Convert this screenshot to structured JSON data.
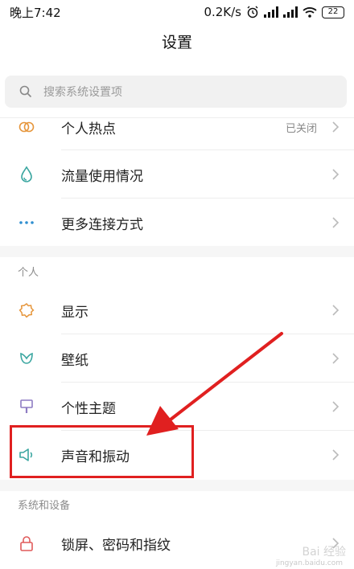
{
  "status": {
    "time": "晚上7:42",
    "speed": "0.2K/s",
    "battery": "22"
  },
  "header": {
    "title": "设置"
  },
  "search": {
    "placeholder": "搜索系统设置项"
  },
  "connection": [
    {
      "label": "个人热点",
      "value": "已关闭",
      "icon": "hotspot-icon"
    },
    {
      "label": "流量使用情况",
      "icon": "data-drop-icon"
    },
    {
      "label": "更多连接方式",
      "icon": "more-dots-icon"
    }
  ],
  "personal": {
    "title": "个人",
    "items": [
      {
        "label": "显示",
        "icon": "display-sun-icon"
      },
      {
        "label": "壁纸",
        "icon": "wallpaper-flower-icon"
      },
      {
        "label": "个性主题",
        "icon": "theme-brush-icon"
      },
      {
        "label": "声音和振动",
        "icon": "speaker-icon"
      }
    ]
  },
  "system": {
    "title": "系统和设备",
    "items": [
      {
        "label": "锁屏、密码和指纹",
        "icon": "lock-icon"
      }
    ]
  },
  "watermark": {
    "text": "Bai 经验",
    "sub": "jingyan.baidu.com"
  },
  "colors": {
    "highlight": "#e02020",
    "teal": "#3aa6a0",
    "orange": "#e6963c",
    "purple": "#8e7cc3",
    "red": "#e05a5a",
    "blue": "#2f8fd0"
  }
}
